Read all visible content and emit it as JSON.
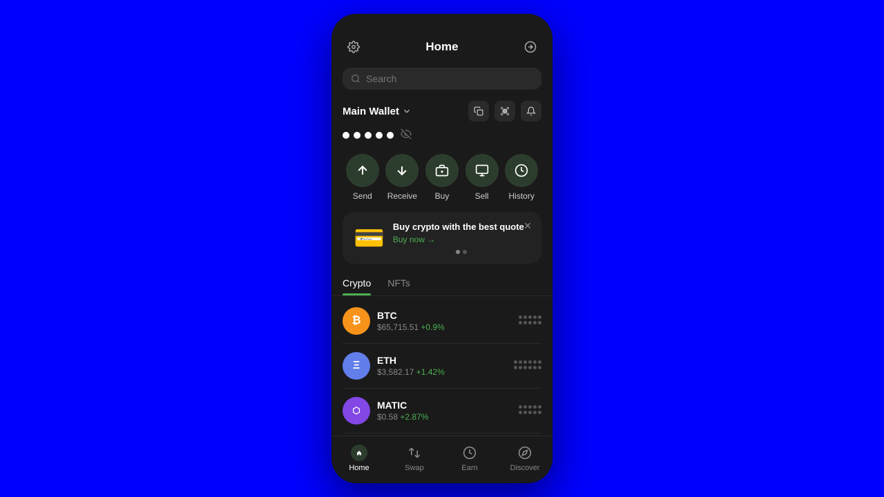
{
  "app": {
    "title": "Home"
  },
  "search": {
    "placeholder": "Search"
  },
  "wallet": {
    "name": "Main Wallet",
    "icons": [
      "copy",
      "scan",
      "bell"
    ]
  },
  "actions": [
    {
      "id": "send",
      "label": "Send",
      "icon": "↑"
    },
    {
      "id": "receive",
      "label": "Receive",
      "icon": "↓"
    },
    {
      "id": "buy",
      "label": "Buy",
      "icon": "🏪"
    },
    {
      "id": "sell",
      "label": "Sell",
      "icon": "🏛"
    },
    {
      "id": "history",
      "label": "History",
      "icon": "📋"
    }
  ],
  "promo": {
    "title": "Buy crypto with the best quote",
    "link": "Buy now →"
  },
  "tabs": [
    {
      "id": "crypto",
      "label": "Crypto",
      "active": true
    },
    {
      "id": "nfts",
      "label": "NFTs",
      "active": false
    }
  ],
  "crypto": [
    {
      "symbol": "BTC",
      "name": "BTC",
      "price": "$65,715.51",
      "change": "+0.9%",
      "color": "#f7931a"
    },
    {
      "symbol": "ETH",
      "name": "ETH",
      "price": "$3,582.17",
      "change": "+1.42%",
      "color": "#627eea"
    },
    {
      "symbol": "MATIC",
      "name": "MATIC",
      "price": "$0.58",
      "change": "+2.87%",
      "color": "#8247e5"
    }
  ],
  "nav": [
    {
      "id": "home",
      "label": "Home",
      "active": true
    },
    {
      "id": "swap",
      "label": "Swap",
      "active": false
    },
    {
      "id": "earn",
      "label": "Earn",
      "active": false
    },
    {
      "id": "discover",
      "label": "Discover",
      "active": false
    }
  ]
}
